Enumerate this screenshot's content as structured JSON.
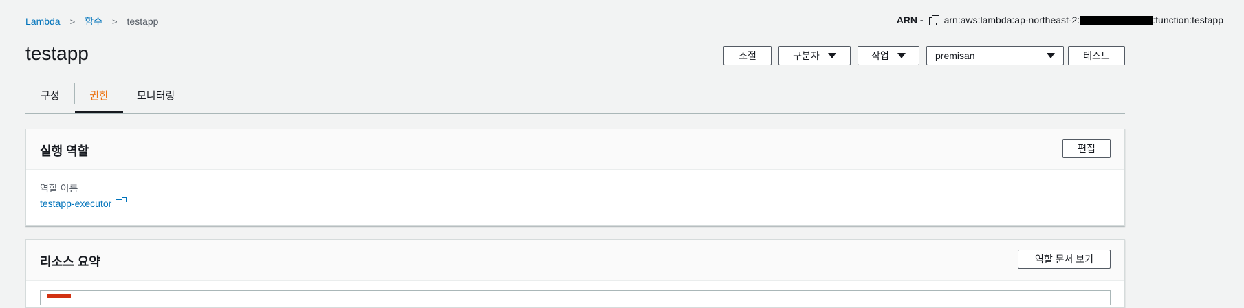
{
  "breadcrumb": {
    "items": [
      "Lambda",
      "함수"
    ],
    "current": "testapp"
  },
  "arn": {
    "label": "ARN -",
    "prefix": "arn:aws:lambda:ap-northeast-2:",
    "suffix": ":function:testapp"
  },
  "page": {
    "title": "testapp"
  },
  "toolbar": {
    "throttle_label": "조절",
    "qualifier_label": "구분자",
    "actions_label": "작업",
    "test_event_value": "premisan",
    "test_label": "테스트"
  },
  "tabs": [
    {
      "label": "구성"
    },
    {
      "label": "권한"
    },
    {
      "label": "모니터링"
    }
  ],
  "execution_role": {
    "title": "실행 역할",
    "edit_label": "편집",
    "role_name_label": "역할 이름",
    "role_name": "testapp-executor"
  },
  "resource_summary": {
    "title": "리소스 요약",
    "view_policy_label": "역할 문서 보기"
  },
  "colors": {
    "link": "#0073bb",
    "active_tab": "#ec7211",
    "background": "#f2f3f3"
  }
}
